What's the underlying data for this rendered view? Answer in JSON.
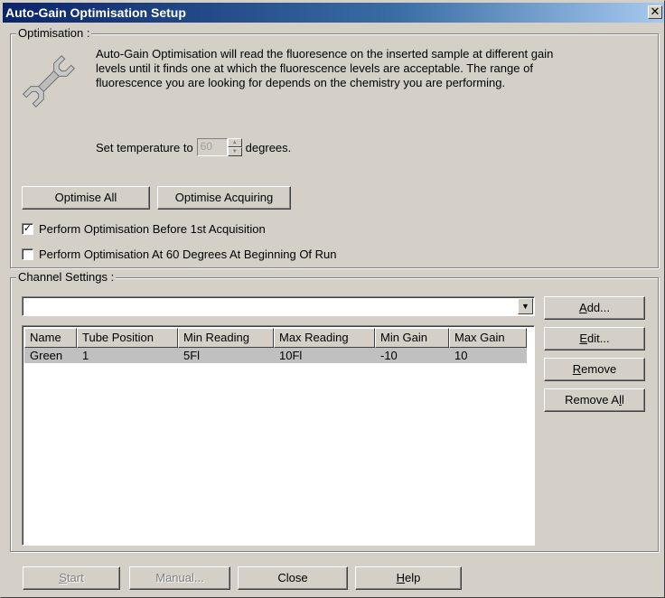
{
  "window": {
    "title": "Auto-Gain Optimisation Setup",
    "close_glyph": "✕"
  },
  "optimisation": {
    "legend": "Optimisation :",
    "icon": "wrench-icon",
    "description": "Auto-Gain Optimisation will read the fluoresence on the inserted sample at different gain levels until it finds one at which the fluorescence levels are acceptable. The range of fluorescence you are looking for depends on the chemistry you are performing.",
    "temp_prefix": "Set temperature to",
    "temp_value": "60",
    "temp_suffix": "degrees.",
    "optimise_all_label": "Optimise All",
    "optimise_acquiring_label": "Optimise Acquiring",
    "check_before_label": "Perform Optimisation Before 1st Acquisition",
    "check_before_checked": true,
    "check_at60_label": "Perform Optimisation At 60 Degrees At Beginning Of Run",
    "check_at60_checked": false
  },
  "channels": {
    "legend": "Channel Settings :",
    "combo_value": "",
    "columns": [
      "Name",
      "Tube Position",
      "Min Reading",
      "Max Reading",
      "Min Gain",
      "Max Gain"
    ],
    "rows": [
      [
        "Green",
        "1",
        "5Fl",
        "10Fl",
        "-10",
        "10"
      ]
    ],
    "add_label": "Add...",
    "add_mnemonic": "A",
    "add_rest": "dd...",
    "edit_mnemonic": "E",
    "edit_rest": "dit...",
    "remove_mnemonic": "R",
    "remove_rest": "emove",
    "removeall_pre": "Remove A",
    "removeall_mnemonic": "l",
    "removeall_post": "l"
  },
  "footer": {
    "start_mnemonic": "S",
    "start_rest": "tart",
    "manual_label": "Manual...",
    "close_label": "Close",
    "help_mnemonic": "H",
    "help_rest": "elp"
  }
}
